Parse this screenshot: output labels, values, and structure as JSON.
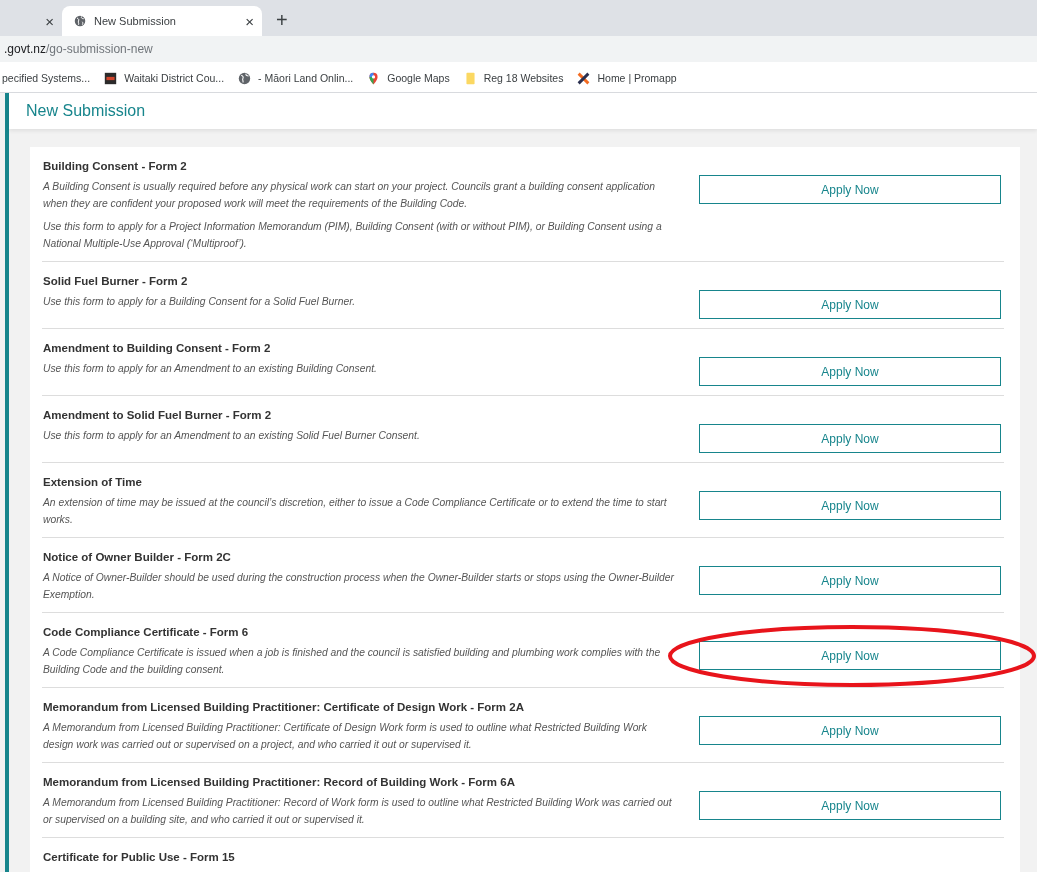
{
  "browser": {
    "tabs": [
      {
        "close": "×",
        "selected": false
      },
      {
        "title": "New Submission",
        "close": "×",
        "selected": true
      }
    ],
    "new_tab": "+",
    "address": {
      "host": ".govt.nz",
      "path": "/go-submission-new"
    },
    "bookmarks": [
      {
        "label": "pecified Systems...",
        "kind": "none"
      },
      {
        "label": "Waitaki District Cou...",
        "kind": "badge"
      },
      {
        "label": "- Māori Land Onlin...",
        "kind": "globe"
      },
      {
        "label": "Google Maps",
        "kind": "pin"
      },
      {
        "label": "Reg 18 Websites",
        "kind": "folder"
      },
      {
        "label": "Home | Promapp",
        "kind": "cross"
      }
    ]
  },
  "page": {
    "title": "New Submission",
    "forms": [
      {
        "title": "Building Consent - Form 2",
        "paragraphs": [
          "A Building Consent is usually required before any physical work can start on your project. Councils grant a building consent application when they are confident your proposed work will meet the requirements of the Building Code.",
          "Use this form to apply for a Project Information Memorandum (PIM), Building Consent (with or without PIM), or Building Consent using a National Multiple-Use Approval (‘Multiproof’)."
        ],
        "button": "Apply Now",
        "circled": false
      },
      {
        "title": "Solid Fuel Burner - Form 2",
        "paragraphs": [
          "Use this form to apply for a Building Consent for a Solid Fuel Burner."
        ],
        "button": "Apply Now",
        "circled": false
      },
      {
        "title": "Amendment to Building Consent - Form 2",
        "paragraphs": [
          "Use this form to apply for an Amendment to an existing Building Consent."
        ],
        "button": "Apply Now",
        "circled": false
      },
      {
        "title": "Amendment to Solid Fuel Burner - Form 2",
        "paragraphs": [
          "Use this form to apply for an Amendment to an existing Solid Fuel Burner Consent."
        ],
        "button": "Apply Now",
        "circled": false
      },
      {
        "title": "Extension of Time",
        "paragraphs": [
          "An extension of time may be issued at the council’s discretion, either to issue a Code Compliance Certificate or to extend the time to start works."
        ],
        "button": "Apply Now",
        "circled": false
      },
      {
        "title": "Notice of Owner Builder - Form 2C",
        "paragraphs": [
          "A Notice of Owner-Builder should be used during the construction process when the Owner-Builder starts or stops using the Owner-Builder Exemption."
        ],
        "button": "Apply Now",
        "circled": false
      },
      {
        "title": "Code Compliance Certificate - Form 6",
        "paragraphs": [
          "A Code Compliance Certificate is issued when a job is finished and the council is satisfied building and plumbing work complies with the Building Code and the building consent."
        ],
        "button": "Apply Now",
        "circled": true
      },
      {
        "title": "Memorandum from Licensed Building Practitioner: Certificate of Design Work - Form 2A",
        "paragraphs": [
          "A Memorandum from Licensed Building Practitioner: Certificate of Design Work form is used to outline what Restricted Building Work design work was carried out or supervised on a project, and who carried it out or supervised it."
        ],
        "button": "Apply Now",
        "circled": false
      },
      {
        "title": "Memorandum from Licensed Building Practitioner: Record of Building Work - Form 6A",
        "paragraphs": [
          "A Memorandum from Licensed Building Practitioner: Record of Work form is used to outline what Restricted Building Work was carried out or supervised on a building site, and who carried it out or supervised it."
        ],
        "button": "Apply Now",
        "circled": false
      },
      {
        "title": "Certificate for Public Use - Form 15"
      }
    ]
  }
}
